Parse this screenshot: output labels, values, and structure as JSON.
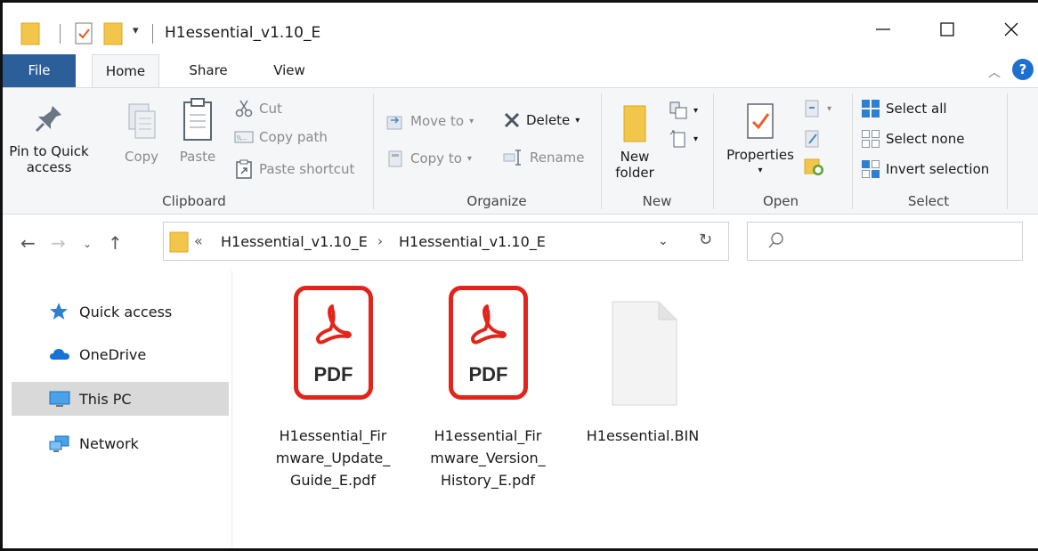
{
  "window": {
    "title": "H1essential_v1.10_E"
  },
  "quick_access_toolbar": {
    "dropdown_glyph": "▾"
  },
  "ribbon_tabs": {
    "file": "File",
    "home": "Home",
    "share": "Share",
    "view": "View"
  },
  "ribbon": {
    "clipboard": {
      "label": "Clipboard",
      "pin_line1": "Pin to Quick",
      "pin_line2": "access",
      "copy": "Copy",
      "paste": "Paste",
      "cut": "Cut",
      "copy_path": "Copy path",
      "paste_shortcut": "Paste shortcut"
    },
    "organize": {
      "label": "Organize",
      "move_to": "Move to",
      "copy_to": "Copy to",
      "delete": "Delete",
      "rename": "Rename"
    },
    "new": {
      "label": "New",
      "new_folder_line1": "New",
      "new_folder_line2": "folder"
    },
    "open": {
      "label": "Open",
      "properties": "Properties"
    },
    "select": {
      "label": "Select",
      "select_all": "Select all",
      "select_none": "Select none",
      "invert_selection": "Invert selection"
    }
  },
  "address_bar": {
    "overflow": "«",
    "segment1": "H1essential_v1.10_E",
    "separator": "›",
    "segment2": "H1essential_v1.10_E"
  },
  "navigation_pane": {
    "items": [
      {
        "label": "Quick access"
      },
      {
        "label": "OneDrive"
      },
      {
        "label": "This PC",
        "selected": true
      },
      {
        "label": "Network"
      }
    ]
  },
  "files": [
    {
      "name": "H1essential_Firmware_Update_Guide_E.pdf",
      "lines": [
        "H1essential_Fir",
        "mware_Update_",
        "Guide_E.pdf"
      ],
      "type_label": "PDF"
    },
    {
      "name": "H1essential_Firmware_Version_History_E.pdf",
      "lines": [
        "H1essential_Fir",
        "mware_Version_",
        "History_E.pdf"
      ],
      "type_label": "PDF"
    },
    {
      "name": "H1essential.BIN",
      "lines": [
        "H1essential.BIN"
      ]
    }
  ],
  "colors": {
    "pdf_red": "#e3241b",
    "accent_blue": "#1e6fd0",
    "selected_bg": "#d9d9d9",
    "file_tab": "#2c5f99"
  }
}
